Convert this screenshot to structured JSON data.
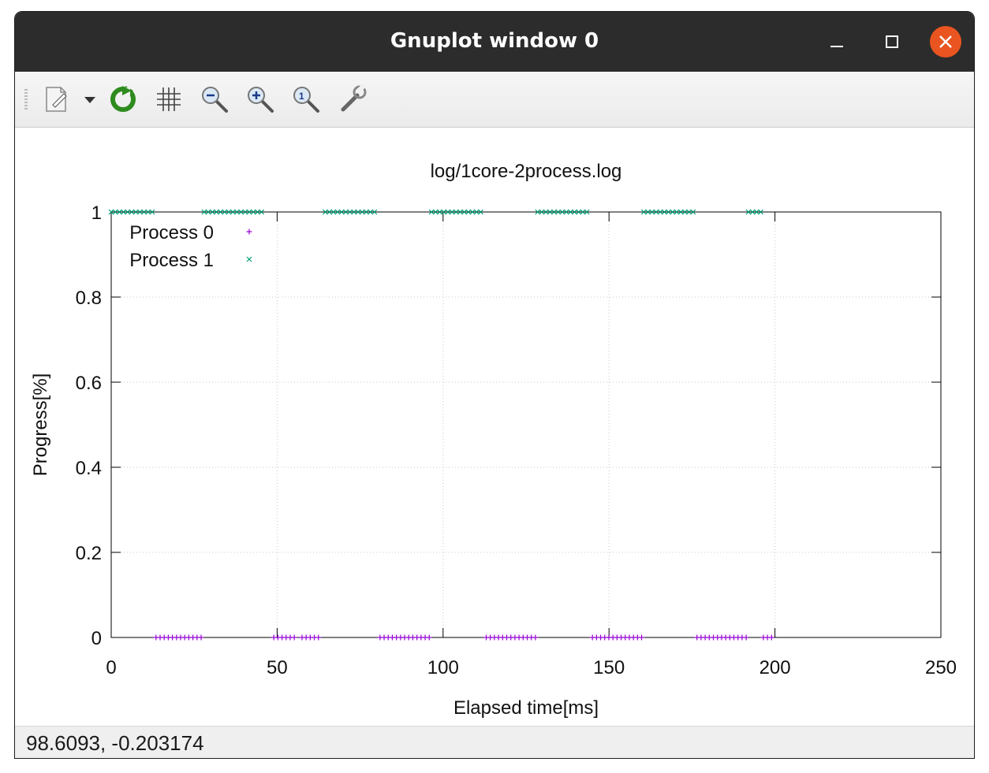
{
  "window": {
    "title": "Gnuplot window 0"
  },
  "toolbar": {
    "items": [
      {
        "name": "export-icon",
        "tooltip": ""
      },
      {
        "name": "replot-icon"
      },
      {
        "name": "grid-icon"
      },
      {
        "name": "zoom-out-icon"
      },
      {
        "name": "zoom-in-icon"
      },
      {
        "name": "zoom-reset-icon"
      },
      {
        "name": "settings-icon"
      }
    ]
  },
  "statusbar": {
    "coordinates": "98.6093, -0.203174"
  },
  "colors": {
    "process0": "#9400d3",
    "process1": "#009e73",
    "close": "#e95420",
    "titlebar": "#2c2c2c"
  },
  "chart_data": {
    "type": "scatter",
    "title": "log/1core-2process.log",
    "xlabel": "Elapsed time[ms]",
    "ylabel": "Progress[%]",
    "xlim": [
      0,
      250
    ],
    "ylim": [
      0,
      1
    ],
    "xticks": [
      "0",
      "50",
      "100",
      "150",
      "200",
      "250"
    ],
    "yticks": [
      "0",
      "0.2",
      "0.4",
      "0.6",
      "0.8",
      "1"
    ],
    "grid": true,
    "legend_position": "top-left",
    "series": [
      {
        "name": "Process 0",
        "marker": "+",
        "segments": [
          [
            13.5,
            27.8
          ],
          [
            49,
            55.5
          ],
          [
            57.5,
            63.5
          ],
          [
            81,
            96.5
          ],
          [
            113,
            128.5
          ],
          [
            145,
            160.5
          ],
          [
            176.5,
            192
          ],
          [
            196.5,
            200
          ]
        ],
        "y": 0
      },
      {
        "name": "Process 1",
        "marker": "x",
        "segments": [
          [
            0,
            13
          ],
          [
            28,
            46.5
          ],
          [
            64.5,
            80.5
          ],
          [
            96.5,
            112
          ],
          [
            128.5,
            144.5
          ],
          [
            160.5,
            176.5
          ],
          [
            192,
            196.5
          ]
        ],
        "y": 1
      }
    ]
  }
}
